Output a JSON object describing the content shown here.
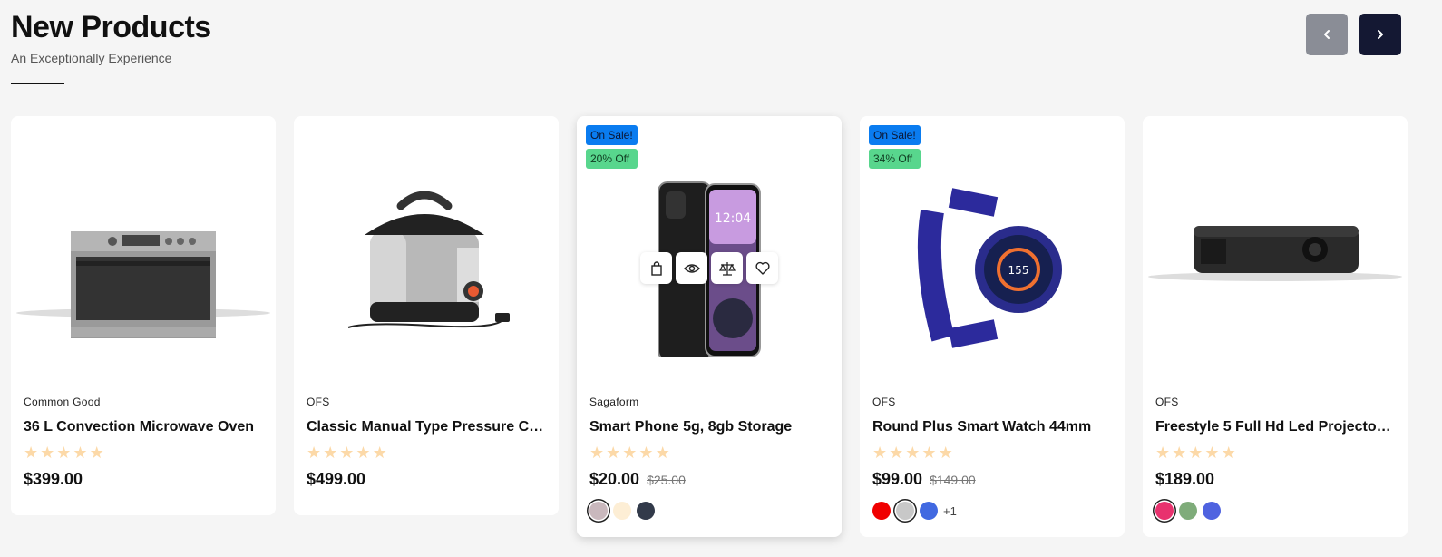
{
  "header": {
    "title": "New Products",
    "subtitle": "An Exceptionally Experience"
  },
  "nav": {
    "prev_icon": "chevron-left-icon",
    "next_icon": "chevron-right-icon"
  },
  "products": [
    {
      "brand": "Common Good",
      "name": "36 L Convection Microwave Oven",
      "rating": 0,
      "price": "$399.00",
      "old_price": "",
      "badges": [],
      "swatches": [],
      "more": ""
    },
    {
      "brand": "OFS",
      "name": "Classic Manual Type Pressure Coo...",
      "rating": 0,
      "price": "$499.00",
      "old_price": "",
      "badges": [],
      "swatches": [],
      "more": ""
    },
    {
      "brand": "Sagaform",
      "name": "Smart Phone 5g, 8gb Storage",
      "rating": 0,
      "price": "$20.00",
      "old_price": "$25.00",
      "badges": [
        "On Sale!",
        "20% Off"
      ],
      "swatches": [
        "#c9b8bd",
        "#fdeed5",
        "#323a4a"
      ],
      "more": ""
    },
    {
      "brand": "OFS",
      "name": "Round Plus Smart Watch 44mm",
      "rating": 0,
      "price": "$99.00",
      "old_price": "$149.00",
      "badges": [
        "On Sale!",
        "34% Off"
      ],
      "swatches": [
        "#f00000",
        "#c8c8c8",
        "#4169e1"
      ],
      "more": "+1"
    },
    {
      "brand": "OFS",
      "name": "Freestyle 5 Full Hd Led Projector - ...",
      "rating": 0,
      "price": "$189.00",
      "old_price": "",
      "badges": [],
      "swatches": [
        "#e8326e",
        "#7fac7a",
        "#4f63e0"
      ],
      "more": ""
    }
  ],
  "hover_actions": [
    "shopping-bag-icon",
    "eye-icon",
    "compare-scale-icon",
    "heart-icon"
  ],
  "colors": {
    "sale_badge": "#0a7cf0",
    "off_badge": "#58d68d",
    "star": "#fcd9a8",
    "next_btn": "#141833",
    "prev_btn": "#8a8d96"
  }
}
